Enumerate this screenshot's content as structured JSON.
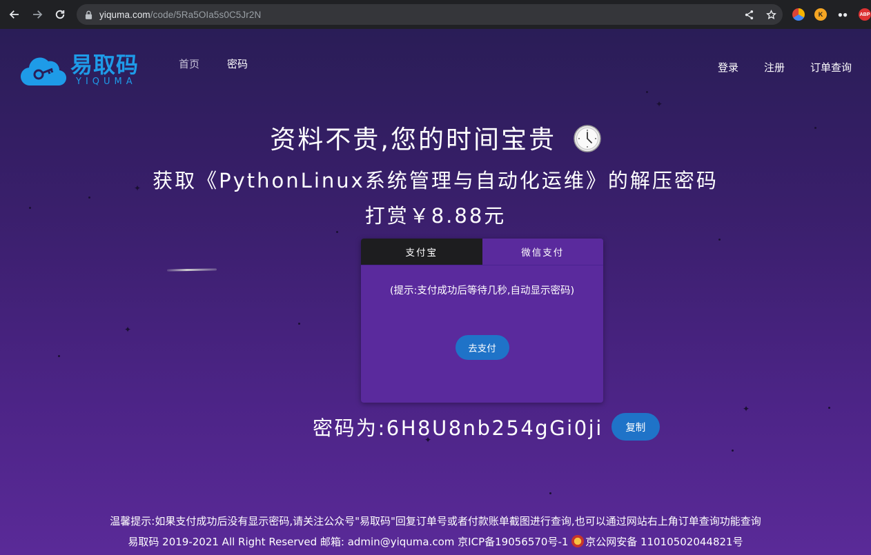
{
  "browser": {
    "url_host": "yiquma.com",
    "url_path": "/code/5Ra5OIa5s0C5Jr2N",
    "extensions": [
      "color-picker-extension-icon",
      "k-extension-icon",
      "spy-extension-icon",
      "adblock-plus-icon"
    ],
    "ext_abp_label": "ABP"
  },
  "logo": {
    "cn": "易取码",
    "en": "YIQUMA"
  },
  "nav": {
    "left": [
      "首页",
      "密码"
    ],
    "active_index": 1,
    "right": [
      "登录",
      "注册",
      "订单查询"
    ]
  },
  "main": {
    "headline": "资料不贵,您的时间宝贵",
    "subtitle": "获取《PythonLinux系统管理与自动化运维》的解压密码",
    "price": "打赏￥8.88元"
  },
  "pay": {
    "tabs": [
      "支付宝",
      "微信支付"
    ],
    "active_tab": 0,
    "hint": "(提示:支付成功后等待几秒,自动显示密码)",
    "button": "去支付"
  },
  "password": {
    "text": "密码为:6H8U8nb254gGi0ji",
    "copy_button": "复制"
  },
  "footer": {
    "notice": "温馨提示:如果支付成功后没有显示密码,请关注公众号\"易取码\"回复订单号或者付款账单截图进行查询,也可以通过网站右上角订单查询功能查询",
    "copyright": "易取码 2019-2021 All Right Reserved  邮箱: admin@yiquma.com  京ICP备19056570号-1",
    "police": "京公网安备 11010502044821号"
  },
  "colors": {
    "accent": "#1e88d8",
    "bg_top": "#2a1d57",
    "bg_bottom": "#5a2a98",
    "tab_active": "#1d1d1f"
  }
}
